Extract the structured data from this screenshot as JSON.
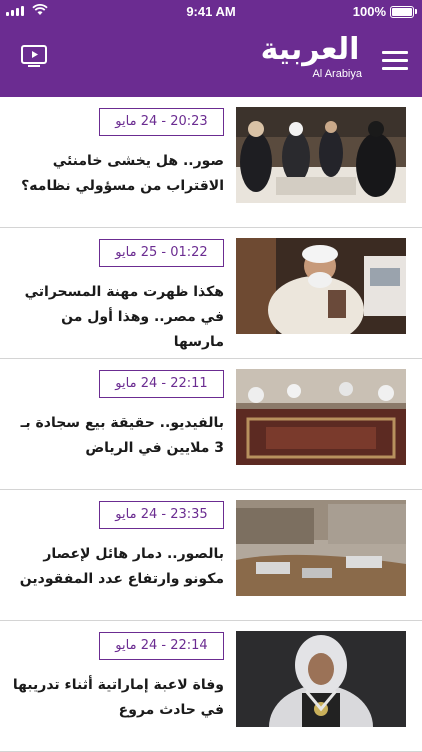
{
  "status_bar": {
    "time": "9:41 AM",
    "battery": "100%"
  },
  "header": {
    "logo_ar": "العربية",
    "logo_en": "Al Arabiya",
    "brand_color": "#6b2c91",
    "icons": {
      "left": "tv-play-icon",
      "right": "hamburger-menu-icon"
    }
  },
  "articles": [
    {
      "time": "20:23",
      "date": "24 مايو",
      "separator": "-",
      "headline": "صور.. هل يخشى خامنئي الاقتراب من مسؤولي نظامه؟"
    },
    {
      "time": "01:22",
      "date": "25 مايو",
      "separator": "-",
      "headline": "هكذا ظهرت مهنة المسحراتي في مصر.. وهذا أول من مارسها"
    },
    {
      "time": "22:11",
      "date": "24 مايو",
      "separator": "-",
      "headline": "بالفيديو.. حقيقة بيع سجادة بـ 3 ملايين في الرياض"
    },
    {
      "time": "23:35",
      "date": "24 مايو",
      "separator": "-",
      "headline": "بالصور.. دمار هائل لإعصار مكونو وارتفاع عدد المفقودين"
    },
    {
      "time": "22:14",
      "date": "24 مايو",
      "separator": "-",
      "headline": "وفاة لاعبة إماراتية أثناء تدريبها في حادث مروع"
    }
  ]
}
